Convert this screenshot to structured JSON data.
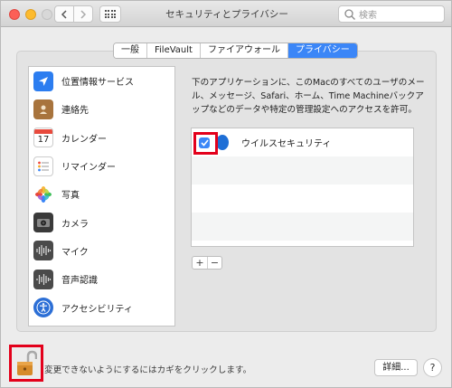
{
  "window": {
    "title": "セキュリティとプライバシー",
    "search_placeholder": "検索"
  },
  "tabs": [
    {
      "label": "一般",
      "active": false
    },
    {
      "label": "FileVault",
      "active": false
    },
    {
      "label": "ファイアウォール",
      "active": false
    },
    {
      "label": "プライバシー",
      "active": true
    }
  ],
  "sidebar": {
    "items": [
      {
        "label": "位置情報サービス",
        "icon": "location-arrow-icon"
      },
      {
        "label": "連絡先",
        "icon": "contacts-book-icon"
      },
      {
        "label": "カレンダー",
        "icon": "calendar-icon",
        "icon_text": "17"
      },
      {
        "label": "リマインダー",
        "icon": "reminders-icon"
      },
      {
        "label": "写真",
        "icon": "photos-icon"
      },
      {
        "label": "カメラ",
        "icon": "camera-icon"
      },
      {
        "label": "マイク",
        "icon": "microphone-waveform-icon"
      },
      {
        "label": "音声認識",
        "icon": "speech-waveform-icon"
      },
      {
        "label": "アクセシビリティ",
        "icon": "accessibility-icon"
      }
    ]
  },
  "main": {
    "description": "下のアプリケーションに、このMacのすべてのユーザのメール、メッセージ、Safari、ホーム、Time Machineバックアップなどのデータや特定の管理設定へのアクセスを許可。",
    "apps": [
      {
        "name": "ウイルスセキュリティ",
        "checked": true
      }
    ],
    "add_label": "+",
    "remove_label": "−"
  },
  "footer": {
    "lock_text": "変更できないようにするにはカギをクリックします。",
    "details_label": "詳細...",
    "help_label": "?"
  },
  "colors": {
    "accent": "#3b86f7",
    "highlight": "#e3001b"
  }
}
